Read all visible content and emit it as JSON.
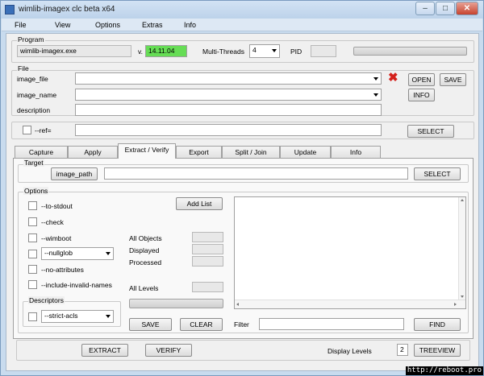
{
  "window": {
    "title": "wimlib-imagex clc beta x64"
  },
  "menu": [
    "File",
    "View",
    "Options",
    "Extras",
    "Info"
  ],
  "program": {
    "group_title": "Program",
    "exe": "wimlib-imagex.exe",
    "version_label": "v.",
    "version": "14.11.04",
    "threads_label": "Multi-Threads",
    "threads_value": "4",
    "pid_label": "PID",
    "pid_value": "",
    "version_color": "#66dd55"
  },
  "file": {
    "group_title": "File",
    "image_file_label": "image_file",
    "image_file_value": "",
    "image_name_label": "image_name",
    "image_name_value": "",
    "description_label": "description",
    "description_value": "",
    "open_button": "OPEN",
    "save_button": "SAVE",
    "info_button": "INFO"
  },
  "ref": {
    "label": "--ref=",
    "value": "",
    "select_button": "SELECT"
  },
  "tabs": [
    "Capture",
    "Apply",
    "Extract / Verify",
    "Export",
    "Split / Join",
    "Update",
    "Info"
  ],
  "active_tab": "Extract / Verify",
  "target": {
    "group_title": "Target",
    "image_path_button": "image_path",
    "value": "",
    "select_button": "SELECT"
  },
  "options": {
    "group_title": "Options",
    "to_stdout": "--to-stdout",
    "check": "--check",
    "wimboot": "--wimboot",
    "nullglob": "--nullglob",
    "no_attributes": "--no-attributes",
    "include_invalid_names": "--include-invalid-names",
    "add_list_button": "Add List",
    "all_objects_label": "All Objects",
    "displayed_label": "Displayed",
    "processed_label": "Processed",
    "all_levels_label": "All Levels",
    "all_objects_value": "",
    "displayed_value": "",
    "processed_value": "",
    "all_levels_value": ""
  },
  "descriptors": {
    "group_title": "Descriptors",
    "strict_acls": "--strict-acls"
  },
  "bottom": {
    "save_button": "SAVE",
    "clear_button": "CLEAR",
    "filter_label": "Filter",
    "filter_value": "",
    "find_button": "FIND"
  },
  "actions": {
    "extract_button": "EXTRACT",
    "verify_button": "VERIFY",
    "display_levels_label": "Display Levels",
    "display_levels_value": "2",
    "treeview_button": "TREEVIEW"
  },
  "watermark": "http://reboot.pro"
}
